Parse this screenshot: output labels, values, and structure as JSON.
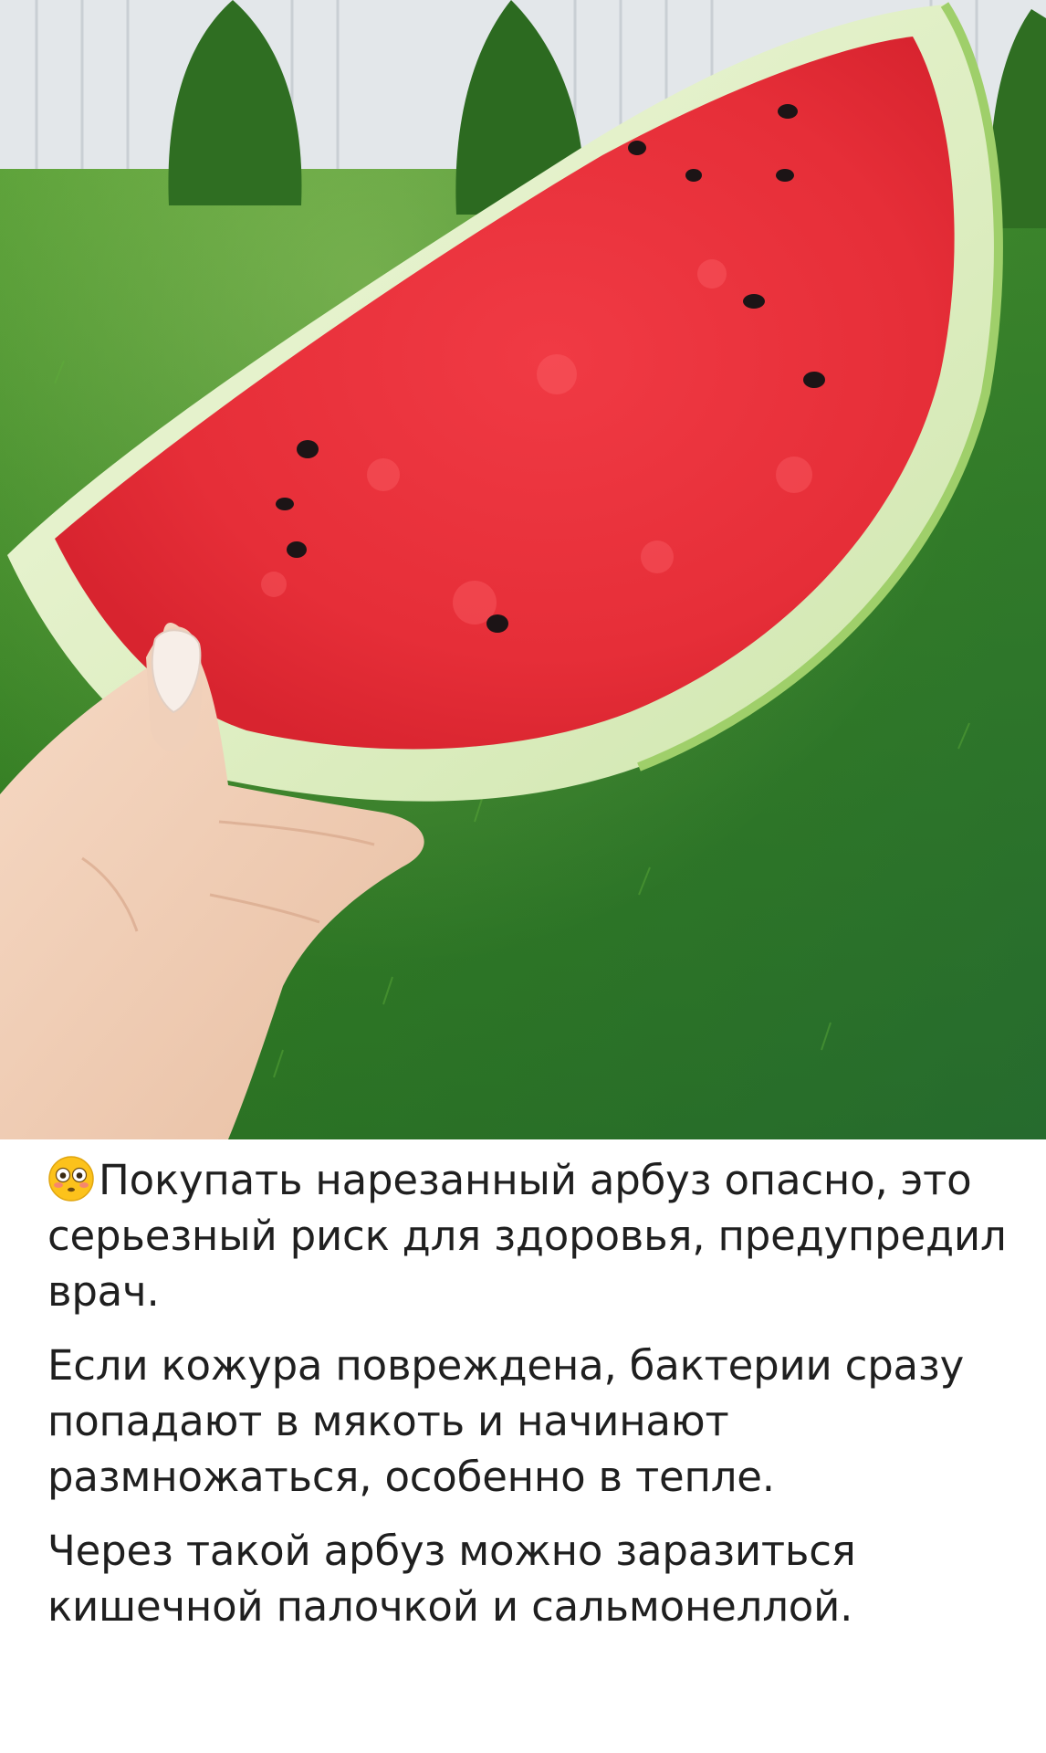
{
  "post": {
    "photo": {
      "subject": "hand holding a slice of watermelon over green grass",
      "icon_name": "watermelon-photo"
    },
    "caption": {
      "emoji": "flushed-face-emoji",
      "paragraphs": [
        "Покупать нарезанный арбуз опасно, это серьезный риск для здоровья, предупредил врач.",
        "Если кожура повреждена, бактерии сразу попадают в мякоть и начинают размножаться, особенно в тепле.",
        "Через такой арбуз можно заразиться кишечной палочкой и сальмонеллой."
      ]
    },
    "colors": {
      "background": "#ffffff",
      "text": "#1f1f1f",
      "grass": "#3f8f2a",
      "flesh": "#e8323c",
      "rind": "#d9eec2"
    }
  }
}
